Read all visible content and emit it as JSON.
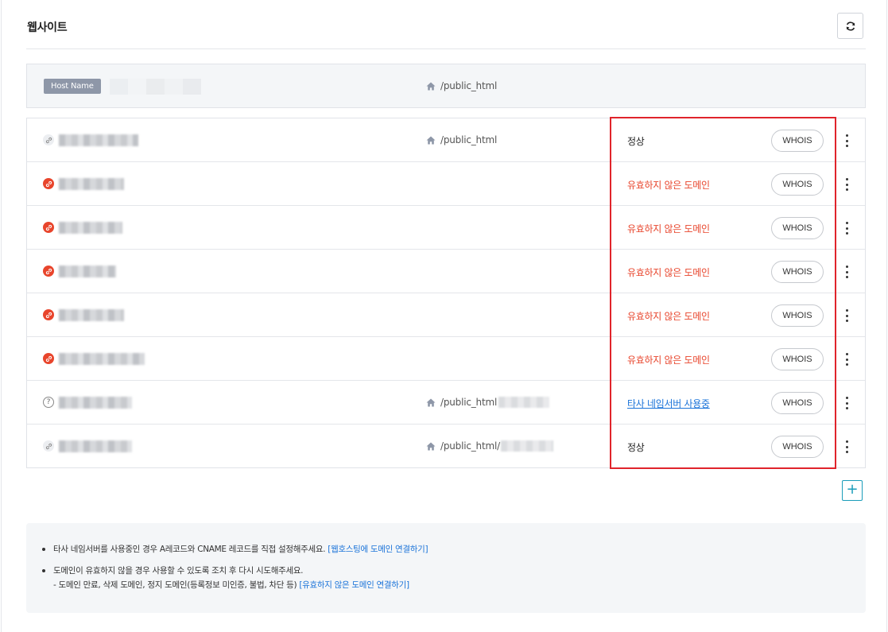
{
  "section": {
    "title": "웹사이트",
    "refresh_icon": "refresh-icon"
  },
  "host": {
    "badge": "Host Name",
    "path": "/public_html"
  },
  "rows": [
    {
      "icon": "link",
      "status": "정상",
      "status_type": "normal",
      "path": "/public_html",
      "whois": "WHOIS"
    },
    {
      "icon": "error",
      "status": "유효하지 않은 도메인",
      "status_type": "error",
      "path": "",
      "whois": "WHOIS"
    },
    {
      "icon": "error",
      "status": "유효하지 않은 도메인",
      "status_type": "error",
      "path": "",
      "whois": "WHOIS"
    },
    {
      "icon": "error",
      "status": "유효하지 않은 도메인",
      "status_type": "error",
      "path": "",
      "whois": "WHOIS"
    },
    {
      "icon": "error",
      "status": "유효하지 않은 도메인",
      "status_type": "error",
      "path": "",
      "whois": "WHOIS"
    },
    {
      "icon": "error",
      "status": "유효하지 않은 도메인",
      "status_type": "error",
      "path": "",
      "whois": "WHOIS"
    },
    {
      "icon": "question",
      "status": "타사 네임서버 사용중",
      "status_type": "link",
      "path": "/public_html",
      "whois": "WHOIS"
    },
    {
      "icon": "link",
      "status": "정상",
      "status_type": "normal",
      "path": "/public_html/",
      "whois": "WHOIS"
    }
  ],
  "add_button": "+",
  "notes": {
    "item1_text": "타사 네임서버를 사용중인 경우 A레코드와 CNAME 레코드를 직접 설정해주세요.",
    "item1_link": "[웹호스팅에 도메인 연결하기]",
    "item2_text": "도메인이 유효하지 않을 경우 사용할 수 있도록 조치 후 다시 시도해주세요.",
    "item2_sub": "- 도메인 만료, 삭제 도메인, 정지 도메인(등록정보 미인증, 불법, 차단 등)",
    "item2_link": "[유효하지 않은 도메인 연결하기]"
  },
  "colors": {
    "error": "#e8452c",
    "link": "#1a73d9",
    "highlight": "#e0242b",
    "accent": "#1a9dba"
  }
}
